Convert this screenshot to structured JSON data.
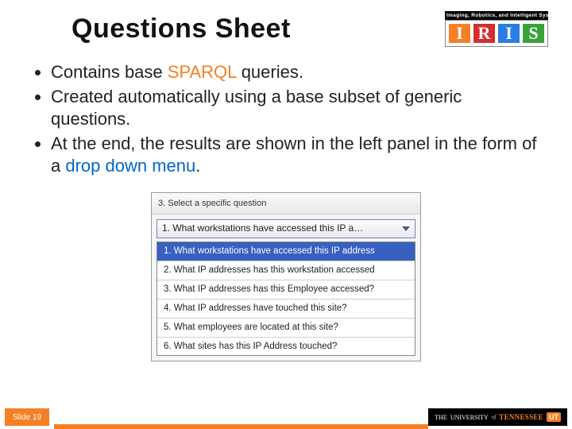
{
  "title": "Questions Sheet",
  "logo": {
    "strap": "Imaging, Robotics, and Intelligent Systems",
    "letters": [
      "I",
      "R",
      "I",
      "S"
    ]
  },
  "bullets": {
    "b1_pre": "Contains base ",
    "b1_hl": "SPARQL",
    "b1_post": " queries.",
    "b2": "Created automatically using a base subset of generic questions.",
    "b3_pre": "At the end, the results are shown in the left panel in the form of a ",
    "b3_hl": "drop down menu",
    "b3_post": "."
  },
  "panel": {
    "caption": "3. Select a specific question",
    "combo_value": "1. What workstations have accessed this IP a…",
    "options": [
      "1. What workstations have accessed this IP address",
      "2. What IP addresses has this workstation accessed",
      "3. What IP addresses has this Employee accessed?",
      "4. What IP addresses have touched this site?",
      "5. What employees are located at this site?",
      "6. What sites has this IP Address touched?"
    ],
    "selected_index": 0
  },
  "footer": {
    "slide_label": "Slide 19",
    "univ_the": "THE",
    "univ_word": "UNIVERSITY",
    "univ_of": "of",
    "univ_tn": "TENNESSEE",
    "univ_icon": "UT"
  }
}
